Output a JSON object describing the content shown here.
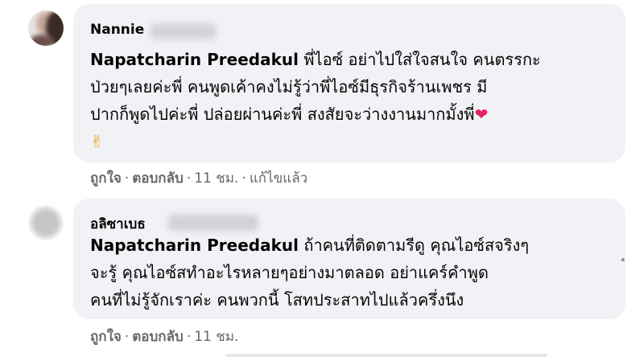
{
  "comments": [
    {
      "author": "Nannie",
      "lines": [
        {
          "mention": "Napatcharin Preedakul",
          "text": " พี่ไอซ์ อย่าไปใส่ใจสนใจ คนตรรกะ"
        },
        {
          "mention": "",
          "text": "ป่วยๆเลยค่ะพี่ คนพูดเค้าคงไม่รู้ว่าพี่ไอซ์มีธุรกิจร้านเพชร มี"
        },
        {
          "mention": "",
          "text": "ปากก็พูดไปค่ะพี่ ปล่อยผ่านค่ะพี่ สงสัยจะว่างงานมากมั้งพี่"
        }
      ],
      "heart": "❤",
      "victory": "✌",
      "actions": {
        "like": "ถูกใจ",
        "reply": "ตอบกลับ",
        "time": "11 ชม.",
        "edited": "แก้ไขแล้ว"
      }
    },
    {
      "author": "อลิซาเบธ",
      "lines": [
        {
          "mention": "Napatcharin Preedakul",
          "text": " ถ้าคนที่ติดตามรีดู คุณไอซ์สจริงๆ"
        },
        {
          "mention": "",
          "text": "จะรู้ คุณไอซ์สทำอะไรหลายๆอย่างมาตลอด อย่าแคร์คำพูด"
        },
        {
          "mention": "",
          "text": "คนที่ไม่รู้จักเราค่ะ คนพวกนี้ โสทประสาทไปแล้วครึ่งนึง"
        }
      ],
      "actions": {
        "like": "ถูกใจ",
        "reply": "ตอบกลับ",
        "time": "11 ชม."
      }
    }
  ],
  "colors": {
    "bubble": "#f0f2f5",
    "meta_text": "#65676b",
    "text": "#050505",
    "heart": "#e0245e"
  },
  "icons": {
    "heart": "heart-emoji-icon",
    "victory": "victory-hand-emoji-icon",
    "more": "more-options-dot-icon"
  }
}
